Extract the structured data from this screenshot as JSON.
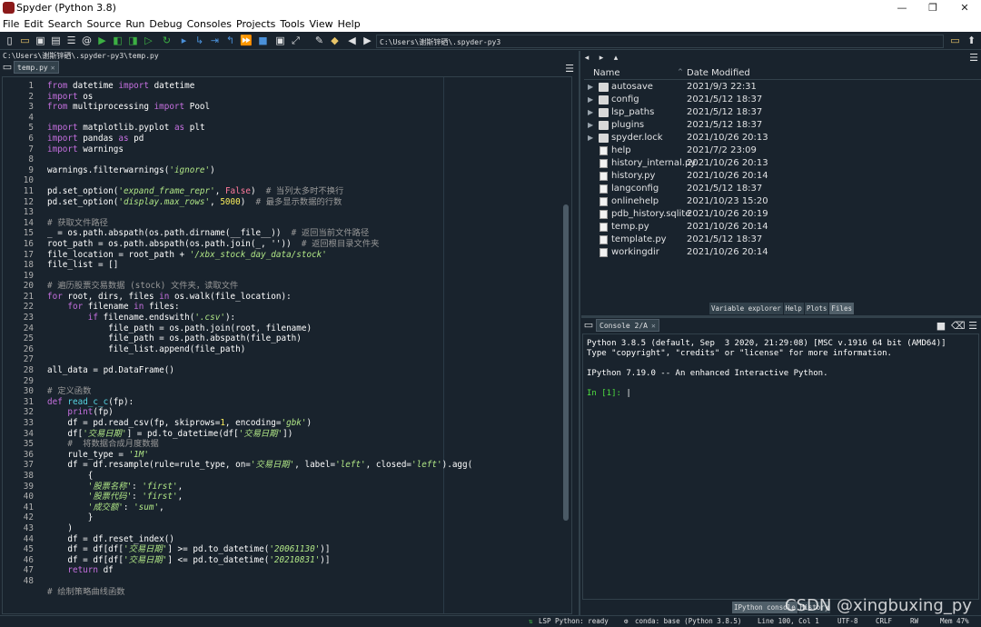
{
  "window": {
    "title": "Spyder (Python 3.8)",
    "min": "—",
    "max": "❐",
    "close": "✕"
  },
  "menu": [
    "File",
    "Edit",
    "Search",
    "Source",
    "Run",
    "Debug",
    "Consoles",
    "Projects",
    "Tools",
    "View",
    "Help"
  ],
  "toolbar": {
    "path": "C:\\Users\\谢斯锌硒\\.spyder-py3"
  },
  "editor": {
    "file_path": "C:\\Users\\谢斯锌硒\\.spyder-py3\\temp.py",
    "tab_label": "temp.py",
    "line_numbers": [
      "1",
      "2",
      "3",
      "4",
      "5",
      "6",
      "7",
      "8",
      "9",
      "10",
      "11",
      "12",
      "13",
      "14",
      "15",
      "16",
      "17",
      "18",
      "19",
      "20",
      "21",
      "22",
      "23",
      "24",
      "25",
      "26",
      "27",
      "28",
      "29",
      "30",
      "31",
      "32",
      "33",
      "34",
      "35",
      "36",
      "37",
      "38",
      "39",
      "40",
      "41",
      "42",
      "43",
      "44",
      "45",
      "46",
      "47",
      "48"
    ],
    "lines": [
      [
        [
          "k",
          "from"
        ],
        [
          "t",
          " datetime "
        ],
        [
          "k",
          "import"
        ],
        [
          "t",
          " datetime"
        ]
      ],
      [
        [
          "k",
          "import"
        ],
        [
          "t",
          " os"
        ]
      ],
      [
        [
          "k",
          "from"
        ],
        [
          "t",
          " multiprocessing "
        ],
        [
          "k",
          "import"
        ],
        [
          "t",
          " Pool"
        ]
      ],
      [],
      [
        [
          "k",
          "import"
        ],
        [
          "t",
          " matplotlib.pyplot "
        ],
        [
          "k",
          "as"
        ],
        [
          "t",
          " plt"
        ]
      ],
      [
        [
          "k",
          "import"
        ],
        [
          "t",
          " pandas "
        ],
        [
          "k",
          "as"
        ],
        [
          "t",
          " pd"
        ]
      ],
      [
        [
          "k",
          "import"
        ],
        [
          "t",
          " warnings"
        ]
      ],
      [],
      [
        [
          "t",
          "warnings.filterwarnings("
        ],
        [
          "s",
          "'ignore'"
        ],
        [
          "t",
          ")"
        ]
      ],
      [],
      [
        [
          "t",
          "pd.set_option("
        ],
        [
          "s",
          "'expand_frame_repr'"
        ],
        [
          "t",
          ", "
        ],
        [
          "b",
          "False"
        ],
        [
          "t",
          ")  "
        ],
        [
          "c",
          "# 当列太多时不换行"
        ]
      ],
      [
        [
          "t",
          "pd.set_option("
        ],
        [
          "s",
          "'display.max_rows'"
        ],
        [
          "t",
          ", "
        ],
        [
          "n",
          "5000"
        ],
        [
          "t",
          ")  "
        ],
        [
          "c",
          "# 最多显示数据的行数"
        ]
      ],
      [],
      [
        [
          "c",
          "# 获取文件路径"
        ]
      ],
      [
        [
          "t",
          "_ = os.path.abspath(os.path.dirname(__file__))  "
        ],
        [
          "c",
          "# 返回当前文件路径"
        ]
      ],
      [
        [
          "t",
          "root_path = os.path.abspath(os.path.join(_, ''))  "
        ],
        [
          "c",
          "# 返回根目录文件夹"
        ]
      ],
      [
        [
          "t",
          "file_location = root_path + "
        ],
        [
          "s",
          "'/xbx_stock_day_data/stock'"
        ]
      ],
      [
        [
          "t",
          "file_list = []"
        ]
      ],
      [],
      [
        [
          "c",
          "# 遍历股票交易数据 (stock) 文件夹，读取文件"
        ]
      ],
      [
        [
          "k",
          "for"
        ],
        [
          "t",
          " root, dirs, files "
        ],
        [
          "k",
          "in"
        ],
        [
          "t",
          " os.walk(file_location):"
        ]
      ],
      [
        [
          "t",
          "    "
        ],
        [
          "k",
          "for"
        ],
        [
          "t",
          " filename "
        ],
        [
          "k",
          "in"
        ],
        [
          "t",
          " files:"
        ]
      ],
      [
        [
          "t",
          "        "
        ],
        [
          "k",
          "if"
        ],
        [
          "t",
          " filename.endswith("
        ],
        [
          "s",
          "'.csv'"
        ],
        [
          "t",
          "):"
        ]
      ],
      [
        [
          "t",
          "            file_path = os.path.join(root, filename)"
        ]
      ],
      [
        [
          "t",
          "            file_path = os.path.abspath(file_path)"
        ]
      ],
      [
        [
          "t",
          "            file_list.append(file_path)"
        ]
      ],
      [],
      [
        [
          "t",
          "all_data = pd.DataFrame()"
        ]
      ],
      [],
      [
        [
          "c",
          "# 定义函数"
        ]
      ],
      [
        [
          "k",
          "def"
        ],
        [
          "t",
          " "
        ],
        [
          "f",
          "read_c_c"
        ],
        [
          "t",
          "(fp):"
        ]
      ],
      [
        [
          "t",
          "    "
        ],
        [
          "k",
          "print"
        ],
        [
          "t",
          "(fp)"
        ]
      ],
      [
        [
          "t",
          "    df = pd.read_csv(fp, skiprows="
        ],
        [
          "n",
          "1"
        ],
        [
          "t",
          ", encoding="
        ],
        [
          "s",
          "'gbk'"
        ],
        [
          "t",
          ")"
        ]
      ],
      [
        [
          "t",
          "    df["
        ],
        [
          "s",
          "'交易日期'"
        ],
        [
          "t",
          "] = pd.to_datetime(df["
        ],
        [
          "s",
          "'交易日期'"
        ],
        [
          "t",
          "])"
        ]
      ],
      [
        [
          "t",
          "    "
        ],
        [
          "c",
          "#  将数据合成月度数据"
        ]
      ],
      [
        [
          "t",
          "    rule_type = "
        ],
        [
          "s",
          "'1M'"
        ]
      ],
      [
        [
          "t",
          "    df = df.resample(rule=rule_type, on="
        ],
        [
          "s",
          "'交易日期'"
        ],
        [
          "t",
          ", label="
        ],
        [
          "s",
          "'left'"
        ],
        [
          "t",
          ", closed="
        ],
        [
          "s",
          "'left'"
        ],
        [
          "t",
          ").agg("
        ]
      ],
      [
        [
          "t",
          "        {"
        ]
      ],
      [
        [
          "t",
          "        "
        ],
        [
          "s",
          "'股票名称'"
        ],
        [
          "t",
          ": "
        ],
        [
          "s",
          "'first'"
        ],
        [
          "t",
          ","
        ]
      ],
      [
        [
          "t",
          "        "
        ],
        [
          "s",
          "'股票代码'"
        ],
        [
          "t",
          ": "
        ],
        [
          "s",
          "'first'"
        ],
        [
          "t",
          ","
        ]
      ],
      [
        [
          "t",
          "        "
        ],
        [
          "s",
          "'成交额'"
        ],
        [
          "t",
          ": "
        ],
        [
          "s",
          "'sum'"
        ],
        [
          "t",
          ","
        ]
      ],
      [
        [
          "t",
          "        }"
        ]
      ],
      [
        [
          "t",
          "    )"
        ]
      ],
      [
        [
          "t",
          "    df = df.reset_index()"
        ]
      ],
      [
        [
          "t",
          "    df = df[df["
        ],
        [
          "s",
          "'交易日期'"
        ],
        [
          "t",
          "] >= pd.to_datetime("
        ],
        [
          "s",
          "'20061130'"
        ],
        [
          "t",
          ")]"
        ]
      ],
      [
        [
          "t",
          "    df = df[df["
        ],
        [
          "s",
          "'交易日期'"
        ],
        [
          "t",
          "] <= pd.to_datetime("
        ],
        [
          "s",
          "'20210831'"
        ],
        [
          "t",
          ")]"
        ]
      ],
      [
        [
          "t",
          "    "
        ],
        [
          "k",
          "return"
        ],
        [
          "t",
          " df"
        ]
      ],
      [],
      [
        [
          "c",
          "# 绘制策略曲线函数"
        ]
      ]
    ]
  },
  "files": {
    "col_name": "Name",
    "col_date": "Date Modified",
    "rows": [
      {
        "name": "autosave",
        "date": "2021/9/3 22:31",
        "kind": "folder"
      },
      {
        "name": "config",
        "date": "2021/5/12 18:37",
        "kind": "folder"
      },
      {
        "name": "lsp_paths",
        "date": "2021/5/12 18:37",
        "kind": "folder"
      },
      {
        "name": "plugins",
        "date": "2021/5/12 18:37",
        "kind": "folder"
      },
      {
        "name": "spyder.lock",
        "date": "2021/10/26 20:13",
        "kind": "folder"
      },
      {
        "name": "help",
        "date": "2021/7/2 23:09",
        "kind": "file"
      },
      {
        "name": "history_internal.py",
        "date": "2021/10/26 20:13",
        "kind": "py"
      },
      {
        "name": "history.py",
        "date": "2021/10/26 20:14",
        "kind": "py"
      },
      {
        "name": "langconfig",
        "date": "2021/5/12 18:37",
        "kind": "file"
      },
      {
        "name": "onlinehelp",
        "date": "2021/10/23 15:20",
        "kind": "file"
      },
      {
        "name": "pdb_history.sqlite",
        "date": "2021/10/26 20:19",
        "kind": "file"
      },
      {
        "name": "temp.py",
        "date": "2021/10/26 20:14",
        "kind": "py"
      },
      {
        "name": "template.py",
        "date": "2021/5/12 18:37",
        "kind": "py"
      },
      {
        "name": "workingdir",
        "date": "2021/10/26 20:14",
        "kind": "file"
      }
    ]
  },
  "right_tabs": {
    "variable_explorer": "Variable explorer",
    "help": "Help",
    "plots": "Plots",
    "files": "Files"
  },
  "console": {
    "tab_label": "Console 2/A",
    "line1": "Python 3.8.5 (default, Sep  3 2020, 21:29:08) [MSC v.1916 64 bit (AMD64)]",
    "line2": "Type \"copyright\", \"credits\" or \"license\" for more information.",
    "line3": "IPython 7.19.0 -- An enhanced Interactive Python.",
    "prompt": "In [1]: "
  },
  "bottom_tabs": {
    "ipython": "IPython console",
    "history": "History"
  },
  "status": {
    "lsp": "LSP Python: ready",
    "conda": "conda: base (Python 3.8.5)",
    "position": "Line 100, Col 1",
    "encoding": "UTF-8",
    "eol": "CRLF",
    "rw": "RW",
    "mem": "Mem 47%"
  },
  "watermark": "CSDN @xingbuxing_py",
  "colors": {
    "bg": "#19232d",
    "keyword": "#c670e0",
    "string": "#b0e686",
    "comment": "#999999",
    "number": "#faed5c",
    "builtin": "#ff7a9c",
    "defname": "#57d6e4"
  }
}
